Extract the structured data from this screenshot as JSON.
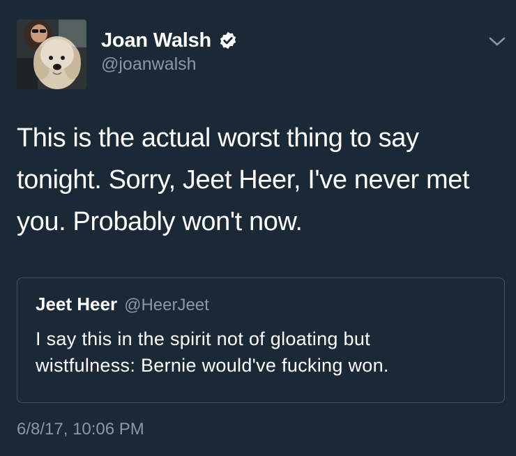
{
  "tweet": {
    "author": {
      "display_name": "Joan Walsh",
      "handle": "@joanwalsh",
      "verified": true,
      "avatar_icon": "avatar-photo-woman-with-dog"
    },
    "text_lines": [
      "This is the actual worst thing to say",
      "tonight. Sorry, Jeet Heer, I've never met",
      "you. Probably won't now."
    ],
    "menu_icon": "chevron-down-icon",
    "timestamp": "6/8/17, 10:06 PM"
  },
  "quoted_tweet": {
    "display_name": "Jeet Heer",
    "handle": "@HeerJeet",
    "text_lines": [
      "I say this in the spirit not of gloating but",
      "wistfulness: Bernie would've fucking won."
    ]
  },
  "colors": {
    "background": "#1b2836",
    "primary_text": "#ffffff",
    "secondary_text": "#8899a6",
    "border": "#3d5466",
    "verified_badge": "#ffffff"
  }
}
